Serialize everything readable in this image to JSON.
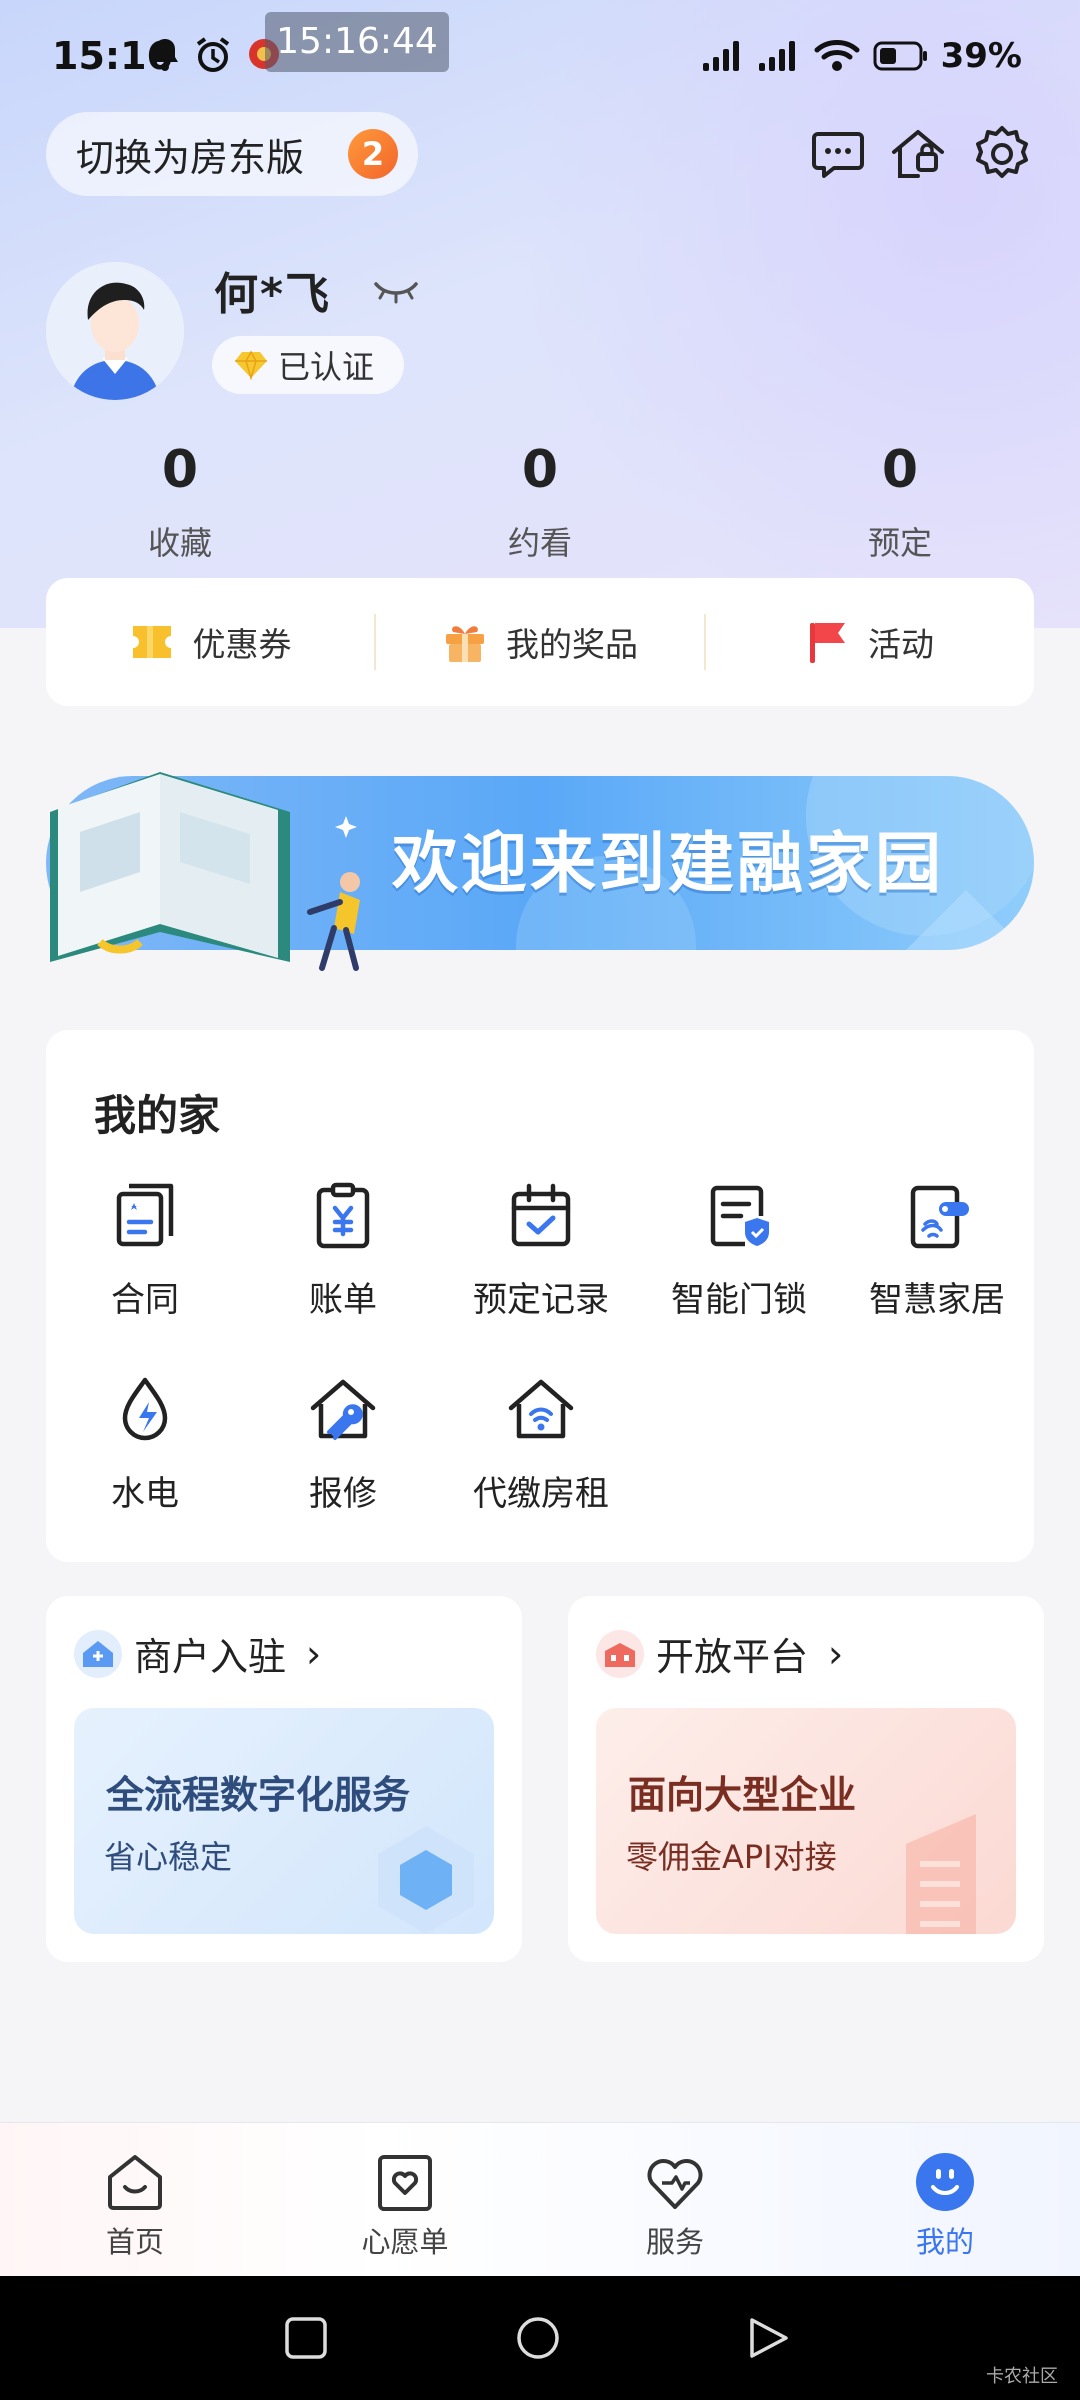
{
  "status_bar": {
    "time": "15:16",
    "overlay_time": "15:16:44",
    "battery": "39%"
  },
  "header": {
    "switch_label": "切换为房东版",
    "switch_badge": "2",
    "icons": [
      "message-icon",
      "house-lock-icon",
      "settings-icon"
    ]
  },
  "profile": {
    "name": "何*飞",
    "verified_label": "已认证"
  },
  "stats": [
    {
      "value": "0",
      "label": "收藏"
    },
    {
      "value": "0",
      "label": "约看"
    },
    {
      "value": "0",
      "label": "预定"
    }
  ],
  "quick_links": [
    {
      "label": "优惠券",
      "icon": "coupon-icon"
    },
    {
      "label": "我的奖品",
      "icon": "gift-icon"
    },
    {
      "label": "活动",
      "icon": "flag-icon"
    }
  ],
  "banner": {
    "text": "欢迎来到建融家园"
  },
  "my_home": {
    "title": "我的家",
    "items": [
      {
        "label": "合同",
        "icon": "contract-icon"
      },
      {
        "label": "账单",
        "icon": "bill-icon"
      },
      {
        "label": "预定记录",
        "icon": "calendar-check-icon"
      },
      {
        "label": "智能门锁",
        "icon": "smart-lock-icon"
      },
      {
        "label": "智慧家居",
        "icon": "smart-home-icon"
      },
      {
        "label": "水电",
        "icon": "utility-icon"
      },
      {
        "label": "报修",
        "icon": "repair-icon"
      },
      {
        "label": "代缴房租",
        "icon": "rent-pay-icon"
      }
    ]
  },
  "promos": [
    {
      "title": "商户入驻",
      "headline": "全流程数字化服务",
      "sub": "省心稳定",
      "accent": "#2f4d7c"
    },
    {
      "title": "开放平台",
      "headline": "面向大型企业",
      "sub": "零佣金API对接",
      "accent": "#7a2e22"
    }
  ],
  "bottom_nav": [
    {
      "label": "首页",
      "icon": "home-icon"
    },
    {
      "label": "心愿单",
      "icon": "wishlist-icon"
    },
    {
      "label": "服务",
      "icon": "service-icon"
    },
    {
      "label": "我的",
      "icon": "profile-icon",
      "active": true
    }
  ],
  "watermark": "卡农社区",
  "colors": {
    "accent_blue": "#3a76ee",
    "badge_orange": "#f2652a",
    "header_bg": "#d6dffb"
  }
}
